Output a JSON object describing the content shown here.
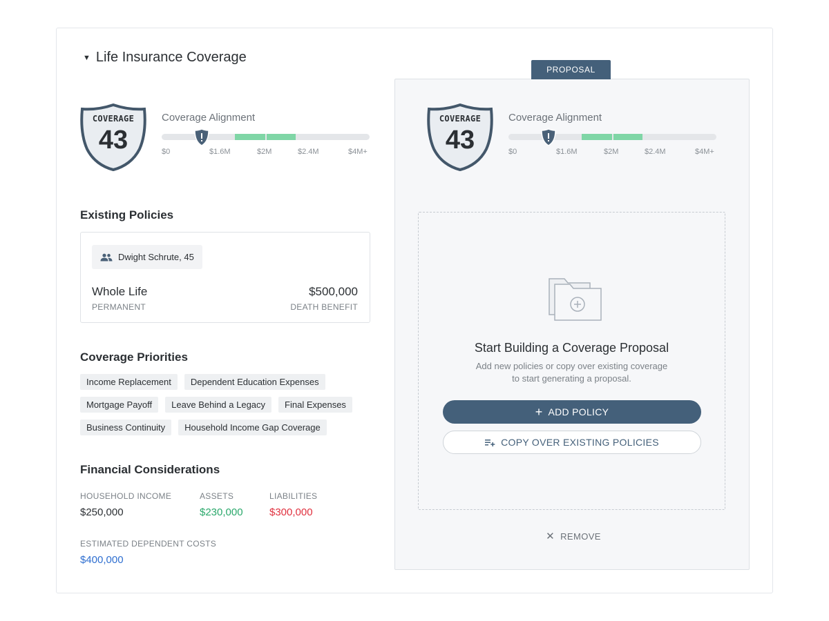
{
  "section": {
    "title": "Life Insurance Coverage",
    "caret_icon": "caret-down-icon"
  },
  "score_left": {
    "badge_label": "COVERAGE",
    "score": "43",
    "alignment_title": "Coverage Alignment",
    "ticks": [
      "$0",
      "$1.6M",
      "$2M",
      "$2.4M",
      "$4M+"
    ]
  },
  "score_right": {
    "badge_label": "COVERAGE",
    "score": "43",
    "alignment_title": "Coverage Alignment",
    "ticks": [
      "$0",
      "$1.6M",
      "$2M",
      "$2.4M",
      "$4M+"
    ]
  },
  "existing_policies": {
    "heading": "Existing Policies",
    "person": "Dwight Schrute, 45",
    "policy_name": "Whole Life",
    "policy_type": "PERMANENT",
    "amount": "$500,000",
    "amount_label": "DEATH BENEFIT"
  },
  "coverage_priorities": {
    "heading": "Coverage Priorities",
    "rows": [
      [
        "Income Replacement",
        "Dependent Education Expenses"
      ],
      [
        "Mortgage Payoff",
        "Leave Behind a Legacy",
        "Final Expenses"
      ],
      [
        "Business Continuity",
        "Household Income Gap Coverage"
      ]
    ]
  },
  "financial": {
    "heading": "Financial Considerations",
    "household_income_label": "HOUSEHOLD INCOME",
    "household_income": "$250,000",
    "assets_label": "ASSETS",
    "assets": "$230,000",
    "liabilities_label": "LIABILITIES",
    "liabilities": "$300,000",
    "dependent_costs_label": "ESTIMATED DEPENDENT COSTS",
    "dependent_costs": "$400,000"
  },
  "proposal": {
    "tab_label": "PROPOSAL",
    "empty_title": "Start Building a Coverage Proposal",
    "empty_sub_line1": "Add new policies or copy over existing coverage",
    "empty_sub_line2": "to start generating a proposal.",
    "add_policy_label": "ADD POLICY",
    "copy_label": "COPY OVER EXISTING POLICIES",
    "remove_label": "REMOVE"
  },
  "colors": {
    "accent": "#44607a",
    "positive": "#2aa86b",
    "negative": "#e0303e",
    "info": "#2f6fd0",
    "range_fill": "#7fd6a6"
  }
}
